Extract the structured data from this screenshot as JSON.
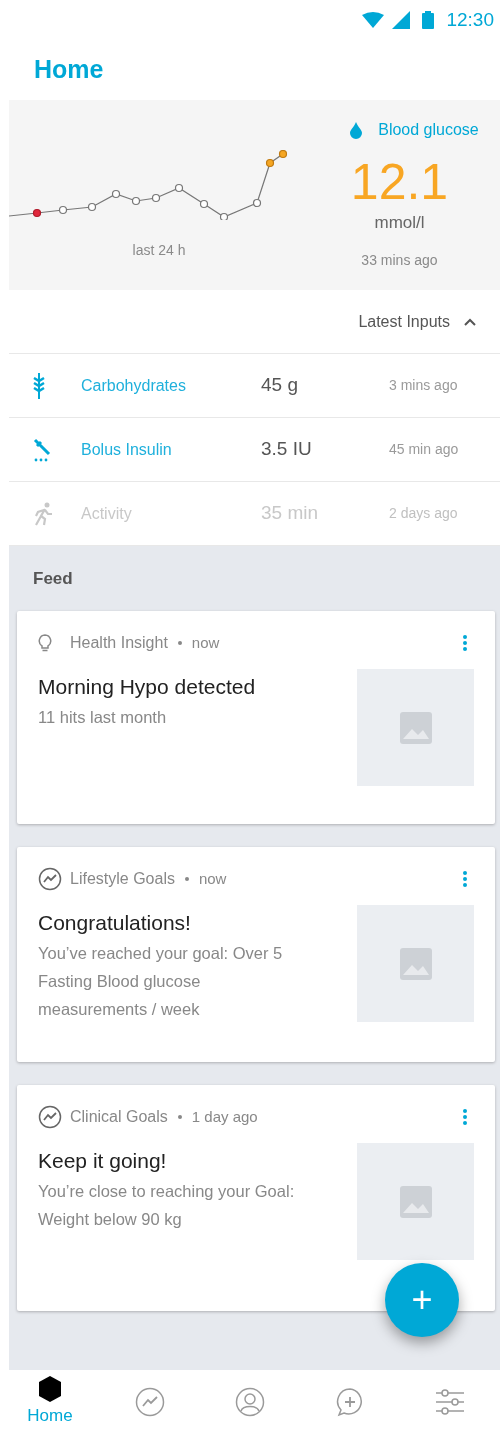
{
  "status_bar": {
    "time": "12:30"
  },
  "header": {
    "title": "Home"
  },
  "glucose": {
    "label": "Blood glucose",
    "value": "12.1",
    "unit": "mmol/l",
    "range_label": "last 24 h",
    "updated": "33 mins ago"
  },
  "latest_inputs": {
    "title": "Latest Inputs",
    "expanded": true,
    "rows": [
      {
        "kind": "carbs",
        "name": "Carbohydrates",
        "amount": "45 g",
        "time": "3 mins ago",
        "disabled": false
      },
      {
        "kind": "insulin",
        "name": "Bolus Insulin",
        "amount": "3.5 IU",
        "time": "45 min ago",
        "disabled": false
      },
      {
        "kind": "activity",
        "name": "Activity",
        "amount": "35 min",
        "time": "2 days ago",
        "disabled": true
      }
    ]
  },
  "feed": {
    "title": "Feed",
    "cards": [
      {
        "kind": "insight",
        "category": "Health Insight",
        "time": "now",
        "title": "Morning Hypo detected",
        "body": "11 hits last month"
      },
      {
        "kind": "goal",
        "category": "Lifestyle Goals",
        "time": "now",
        "title": "Congratulations!",
        "body": "You’ve reached your goal: Over 5 Fasting Blood glucose measurements / week"
      },
      {
        "kind": "goal",
        "category": "Clinical Goals",
        "time": "1 day ago",
        "title": "Keep it going!",
        "body": "You’re close to reaching your Goal: Weight below 90 kg"
      }
    ]
  },
  "fab": {
    "label": "+"
  },
  "nav": [
    {
      "kind": "home",
      "label": "Home",
      "selected": true
    },
    {
      "kind": "trends",
      "selected": false
    },
    {
      "kind": "profile",
      "selected": false
    },
    {
      "kind": "chat",
      "selected": false
    },
    {
      "kind": "settings",
      "selected": false
    }
  ]
}
